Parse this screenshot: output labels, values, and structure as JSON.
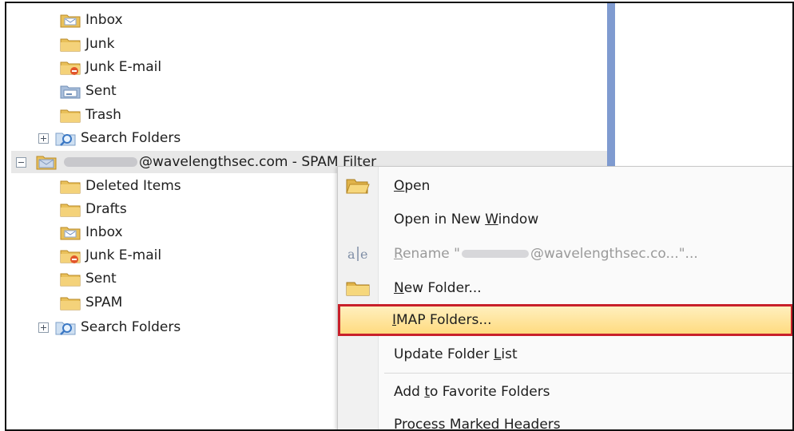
{
  "folder_tree": {
    "top_folders": [
      {
        "label": "Inbox",
        "icon": "inbox-folder-icon"
      },
      {
        "label": "Junk",
        "icon": "folder-icon"
      },
      {
        "label": "Junk E-mail",
        "icon": "junk-email-folder-icon"
      },
      {
        "label": "Sent",
        "icon": "sent-folder-icon"
      },
      {
        "label": "Trash",
        "icon": "folder-icon"
      }
    ],
    "top_search_folders": "Search Folders",
    "account": {
      "label_suffix": "@wavelengthsec.com - SPAM Filter"
    },
    "account_folders": [
      {
        "label": "Deleted Items",
        "icon": "folder-icon"
      },
      {
        "label": "Drafts",
        "icon": "folder-icon"
      },
      {
        "label": "Inbox",
        "icon": "inbox-folder-icon"
      },
      {
        "label": "Junk E-mail",
        "icon": "junk-email-folder-icon"
      },
      {
        "label": "Sent",
        "icon": "folder-icon"
      },
      {
        "label": "SPAM",
        "icon": "folder-icon"
      }
    ],
    "account_search_folders": "Search Folders"
  },
  "context_menu": {
    "open": {
      "pre": "",
      "key": "O",
      "post": "pen"
    },
    "open_new_window": {
      "pre": "Open in New ",
      "key": "W",
      "post": "indow"
    },
    "rename": {
      "pre": "",
      "key": "R",
      "post": "ename \"",
      "suffix": "@wavelengthsec.co...\"..."
    },
    "new_folder": {
      "pre": "",
      "key": "N",
      "post": "ew Folder..."
    },
    "imap_folders": {
      "pre": "",
      "key": "I",
      "post": "MAP Folders..."
    },
    "update_folder_list": {
      "pre": "Update Folder ",
      "key": "L",
      "post": "ist"
    },
    "add_favorites": {
      "pre": "Add ",
      "key": "t",
      "post": "o Favorite Folders"
    },
    "process_headers": {
      "pre": "Process ",
      "key": "M",
      "post": "arked Headers"
    }
  },
  "colors": {
    "splitter": "#7f9bd0",
    "highlight_outline": "#c8202a",
    "highlight_fill": "#ffd97a",
    "account_row": "#e8e8e8"
  }
}
